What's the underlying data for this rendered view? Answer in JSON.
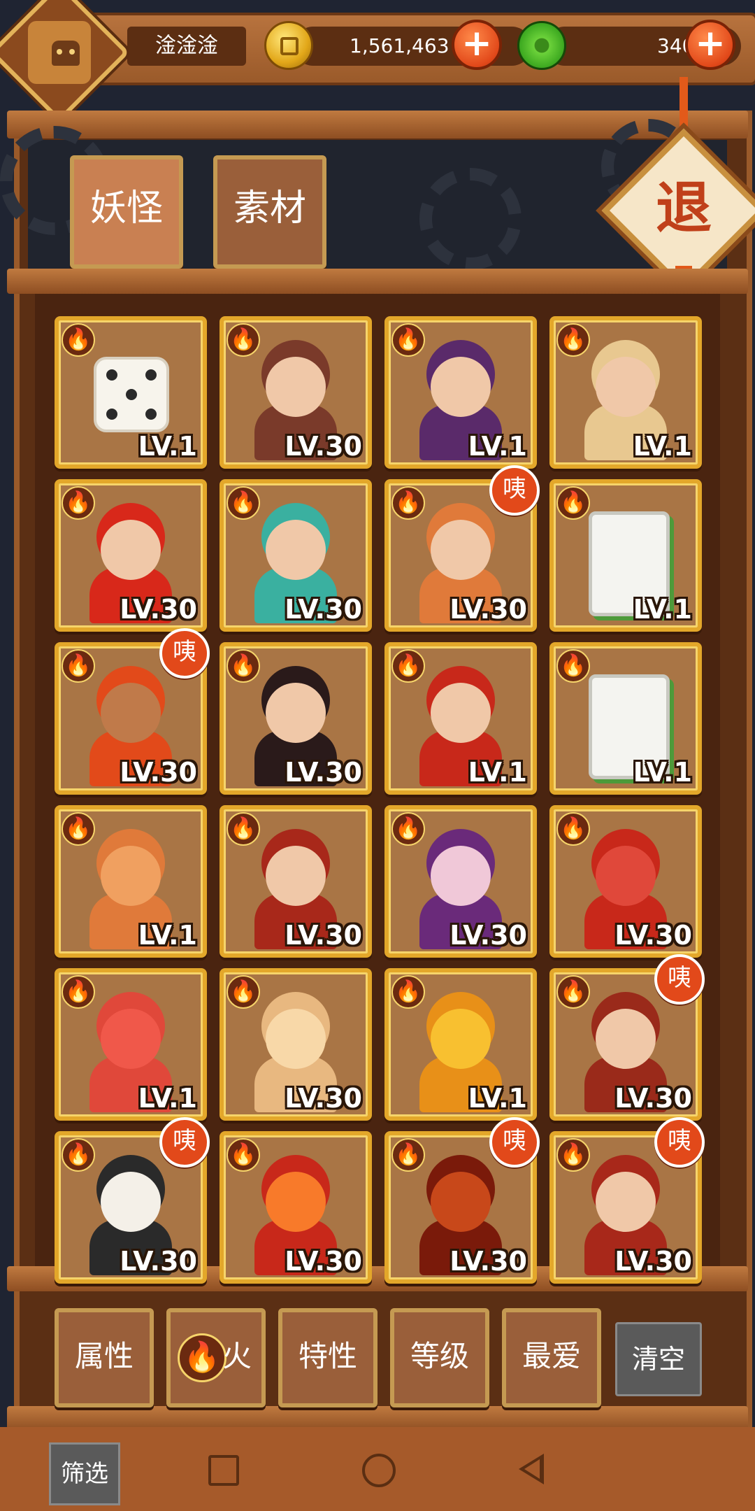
{
  "player": {
    "name": "淦淦淦"
  },
  "resources": {
    "coins": "1,561,463",
    "jade": "340"
  },
  "tabs": [
    {
      "label": "妖怪",
      "active": true
    },
    {
      "label": "素材",
      "active": false
    }
  ],
  "exit_label": "退",
  "badge_text": "咦",
  "cards": [
    {
      "level": "LV.1",
      "art": "dice",
      "badge": false
    },
    {
      "level": "LV.30",
      "art": "girl-headphones",
      "badge": false
    },
    {
      "level": "LV.1",
      "art": "crown-queen",
      "badge": false
    },
    {
      "level": "LV.1",
      "art": "drum",
      "badge": false
    },
    {
      "level": "LV.30",
      "art": "fire-hair",
      "badge": false
    },
    {
      "level": "LV.30",
      "art": "goggles-kid",
      "badge": false
    },
    {
      "level": "LV.30",
      "art": "fox-girl",
      "badge": true
    },
    {
      "level": "LV.1",
      "art": "mahjong-red",
      "badge": false
    },
    {
      "level": "LV.30",
      "art": "monkey-king",
      "badge": true
    },
    {
      "level": "LV.30",
      "art": "dark-hair-girl",
      "badge": false
    },
    {
      "level": "LV.1",
      "art": "santa",
      "badge": false
    },
    {
      "level": "LV.1",
      "art": "mahjong-green",
      "badge": false
    },
    {
      "level": "LV.1",
      "art": "fox",
      "badge": false
    },
    {
      "level": "LV.30",
      "art": "warrior",
      "badge": false
    },
    {
      "level": "LV.30",
      "art": "pink-girl",
      "badge": false
    },
    {
      "level": "LV.30",
      "art": "phoenix",
      "badge": false
    },
    {
      "level": "LV.1",
      "art": "heart",
      "badge": false
    },
    {
      "level": "LV.30",
      "art": "seed-sprite",
      "badge": false
    },
    {
      "level": "LV.1",
      "art": "flame-blob",
      "badge": false
    },
    {
      "level": "LV.30",
      "art": "pirate",
      "badge": true
    },
    {
      "level": "LV.30",
      "art": "cat-ninja",
      "badge": true
    },
    {
      "level": "LV.30",
      "art": "flame-lion",
      "badge": false
    },
    {
      "level": "LV.30",
      "art": "dragon-mask",
      "badge": true
    },
    {
      "level": "LV.30",
      "art": "fat-general",
      "badge": true
    }
  ],
  "filters": [
    {
      "label": "属性"
    },
    {
      "label": "火",
      "icon": "fire-icon"
    },
    {
      "label": "特性"
    },
    {
      "label": "等级"
    },
    {
      "label": "最爱"
    }
  ],
  "clear_label": "清空",
  "screen_filter_label": "筛选",
  "colors": {
    "card_border": "#e3a72a",
    "badge": "#e2491a",
    "frame": "#9a5a2a"
  }
}
